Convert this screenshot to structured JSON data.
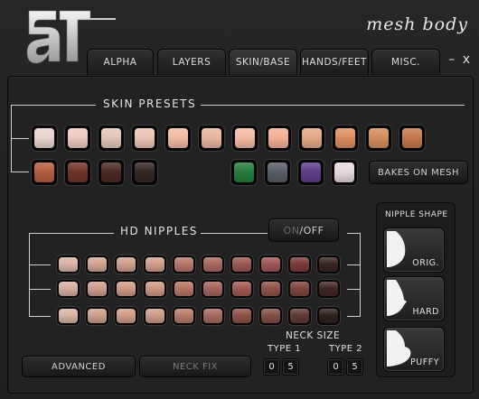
{
  "brand": {
    "text": "mesh body"
  },
  "tabs": [
    "ALPHA",
    "LAYERS",
    "SKIN/BASE",
    "HANDS/FEET",
    "MISC."
  ],
  "window_controls": {
    "minimize": "–",
    "close": "x"
  },
  "skin_presets": {
    "title": "SKIN PRESETS",
    "row1_colors": [
      "#e8d3cd",
      "#efc9c1",
      "#e2c6b6",
      "#ebc3b5",
      "#f0bba2",
      "#e9b5a2",
      "#f2b9a2",
      "#f4af94",
      "#e2a884",
      "#dc8e5f",
      "#d38c5e",
      "#c6774d"
    ],
    "row2_colors": [
      "#b35d3f",
      "#6f3429",
      "#4a2a22",
      "#362624"
    ],
    "extra_colors": [
      "#247d3a",
      "#595d66",
      "#5e3f88",
      "#e5d7de"
    ],
    "bakes_button": "BAKES ON MESH"
  },
  "hd_nipples": {
    "title": "HD NIPPLES",
    "toggle": {
      "on": "ON",
      "sep": "/",
      "off": "OFF"
    },
    "rows": [
      [
        "#d9b4a6",
        "#d4a492",
        "#cf9e8d",
        "#d19e8c",
        "#b47668",
        "#a6685f",
        "#9b5852",
        "#a05758",
        "#7a3b39",
        "#3a2422"
      ],
      [
        "#d4af9e",
        "#cd9f8d",
        "#d09a87",
        "#cd9784",
        "#b47566",
        "#a2645b",
        "#9e5a50",
        "#8f5349",
        "#7d463d",
        "#402723"
      ],
      [
        "#d5b4a2",
        "#cda08a",
        "#cf9c86",
        "#cd9b86",
        "#b67a69",
        "#a56a5e",
        "#8c5246",
        "#835045",
        "#5c3b33",
        "#2f1f1c"
      ]
    ]
  },
  "nipple_shape": {
    "title": "NIPPLE SHAPE",
    "options": [
      "ORIG.",
      "HARD",
      "PUFFY"
    ]
  },
  "advanced_button": "ADVANCED",
  "neck_fix_button": "NECK FIX",
  "neck_size": {
    "title": "NECK SIZE",
    "type1": {
      "label": "TYPE 1",
      "digits": [
        "0",
        "5"
      ]
    },
    "type2": {
      "label": "TYPE 2",
      "digits": [
        "0",
        "5"
      ]
    }
  }
}
